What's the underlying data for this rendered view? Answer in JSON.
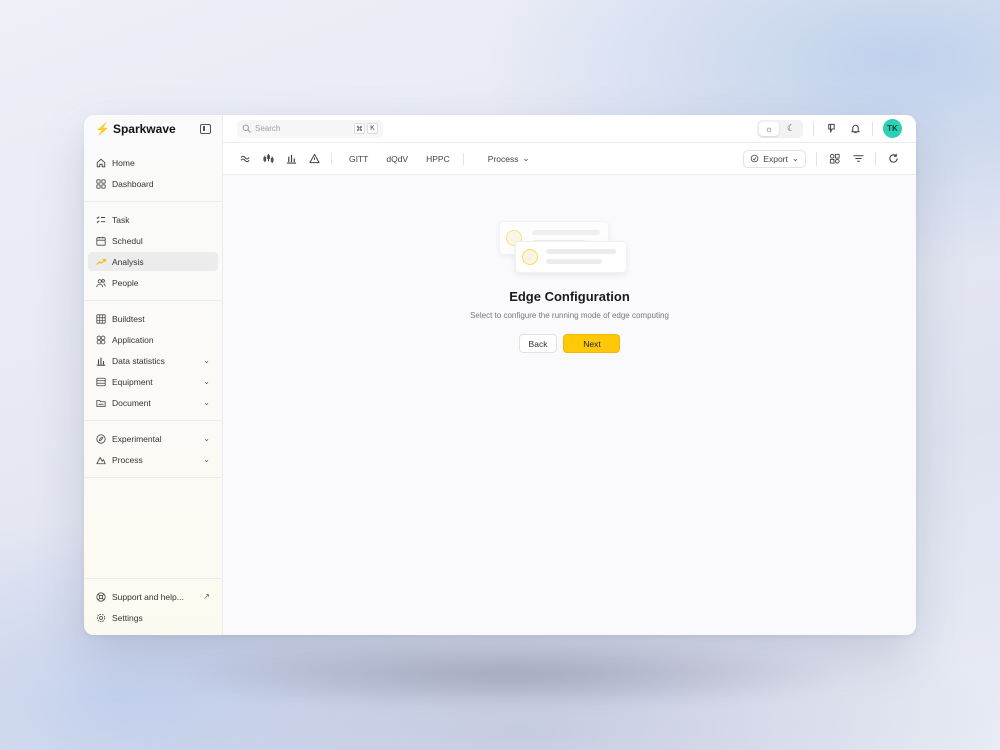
{
  "brand": {
    "name": "Sparkwave",
    "bolt_icon": "lightning-icon"
  },
  "sidebar": {
    "groups": [
      [
        {
          "label": "Home",
          "icon": "home-icon"
        },
        {
          "label": "Dashboard",
          "icon": "grid-icon"
        }
      ],
      [
        {
          "label": "Task",
          "icon": "checklist-icon"
        },
        {
          "label": "Schedul",
          "icon": "calendar-icon"
        },
        {
          "label": "Analysis",
          "icon": "trend-icon",
          "active": true
        },
        {
          "label": "People",
          "icon": "people-icon"
        }
      ],
      [
        {
          "label": "Buildtest",
          "icon": "table-icon"
        },
        {
          "label": "Application",
          "icon": "apps-icon"
        },
        {
          "label": "Data statistics",
          "icon": "bar-chart-icon",
          "expandable": true
        },
        {
          "label": "Equipment",
          "icon": "equipment-icon",
          "expandable": true
        },
        {
          "label": "Document",
          "icon": "folder-icon",
          "expandable": true
        }
      ],
      [
        {
          "label": "Experimental",
          "icon": "compass-icon",
          "expandable": true
        },
        {
          "label": "Process",
          "icon": "mountain-icon",
          "expandable": true
        }
      ]
    ],
    "footer": [
      {
        "label": "Support and help...",
        "icon": "lifebuoy-icon",
        "trailing": "↗"
      },
      {
        "label": "Settings",
        "icon": "gear-icon"
      }
    ]
  },
  "topbar": {
    "search_placeholder": "Search",
    "shortcut_keys": [
      "⌘",
      "K"
    ],
    "avatar_initials": "TK",
    "avatar_color": "#2ad1b5"
  },
  "toolbar": {
    "tabs": [
      "GITT",
      "dQdV",
      "HPPC"
    ],
    "process_label": "Process",
    "export_label": "Export"
  },
  "empty_state": {
    "title": "Edge Configuration",
    "subtitle": "Select to configure the running mode of edge computing",
    "back_label": "Back",
    "next_label": "Next"
  },
  "colors": {
    "accent": "#ffc90a",
    "brand_bolt": "#f5c000"
  }
}
